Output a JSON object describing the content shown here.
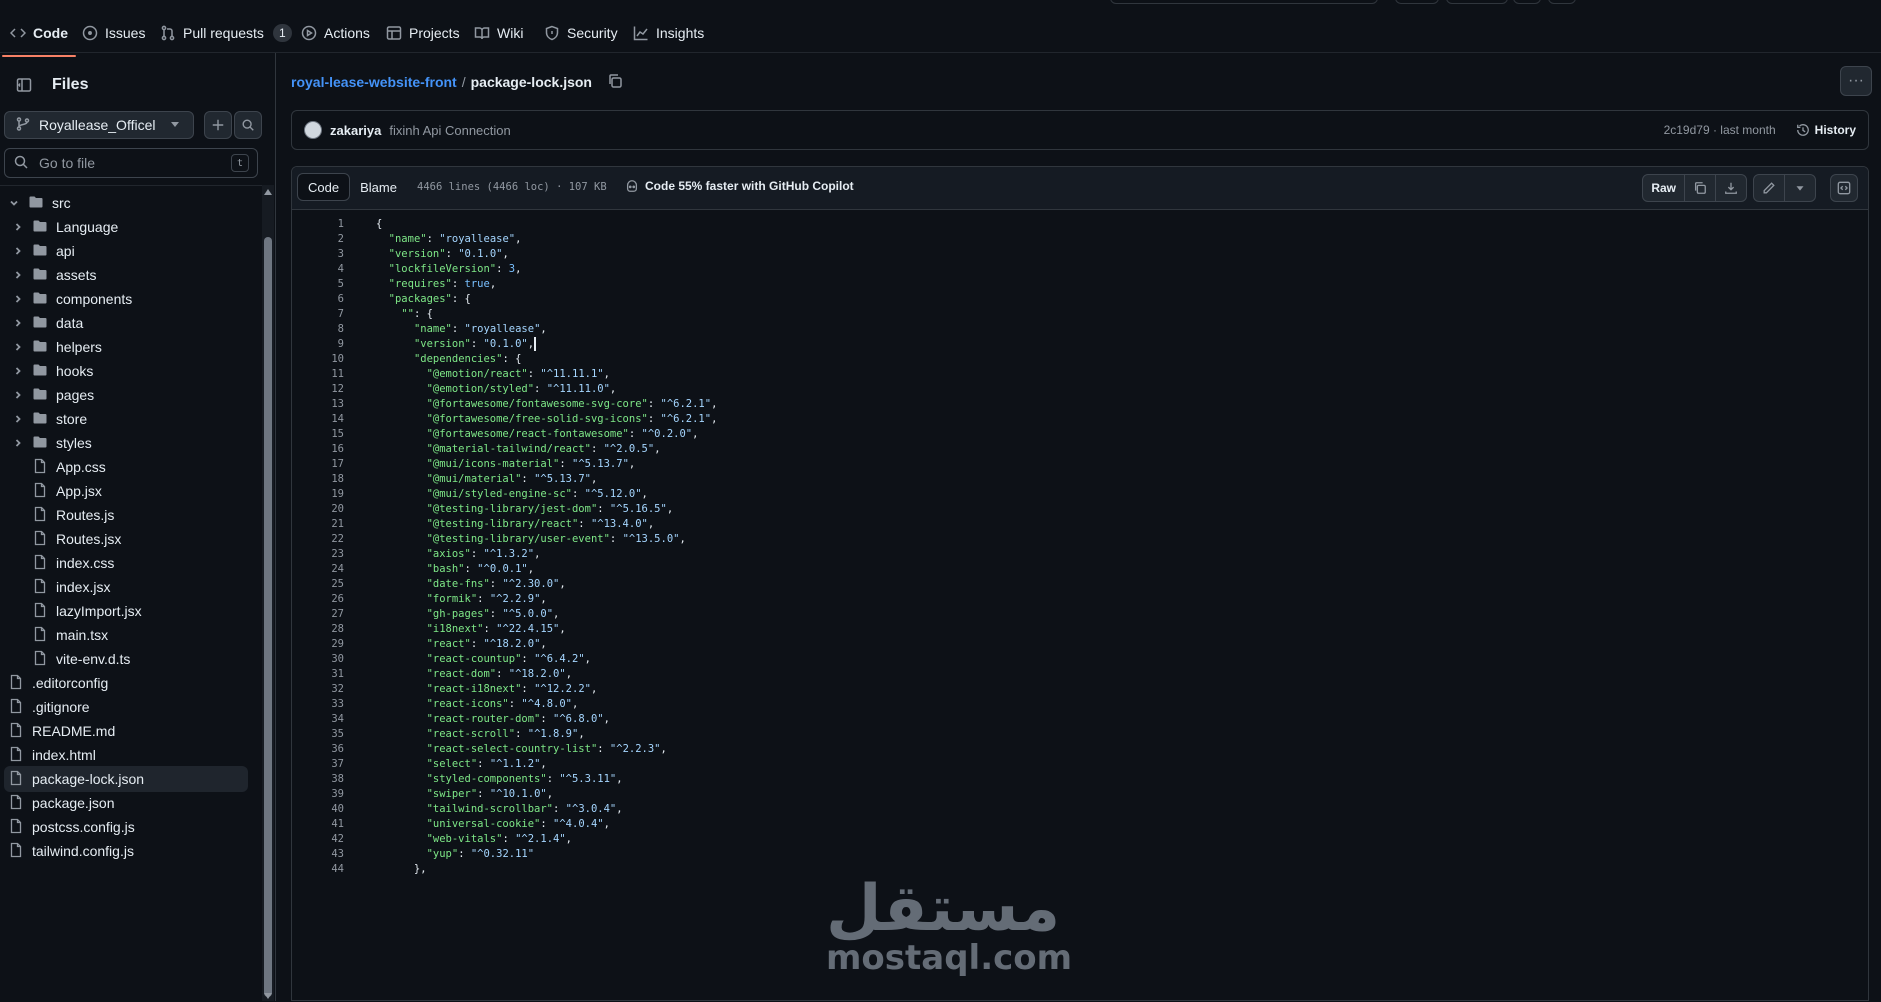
{
  "nav": {
    "tabs": [
      {
        "label": "Code",
        "icon": "code-icon",
        "selected": true
      },
      {
        "label": "Issues",
        "icon": "issue-icon"
      },
      {
        "label": "Pull requests",
        "icon": "pull-request-icon",
        "count": "1"
      },
      {
        "label": "Actions",
        "icon": "play-icon"
      },
      {
        "label": "Projects",
        "icon": "table-icon"
      },
      {
        "label": "Wiki",
        "icon": "book-icon"
      },
      {
        "label": "Security",
        "icon": "shield-icon"
      },
      {
        "label": "Insights",
        "icon": "graph-icon"
      }
    ]
  },
  "sidebar": {
    "title": "Files",
    "branch": "Royallease_Officel",
    "goto_placeholder": "Go to file",
    "goto_shortcut": "t",
    "tree": [
      {
        "label": "src",
        "type": "folder",
        "level": 0,
        "open": true
      },
      {
        "label": "Language",
        "type": "folder",
        "level": 1
      },
      {
        "label": "api",
        "type": "folder",
        "level": 1
      },
      {
        "label": "assets",
        "type": "folder",
        "level": 1
      },
      {
        "label": "components",
        "type": "folder",
        "level": 1
      },
      {
        "label": "data",
        "type": "folder",
        "level": 1
      },
      {
        "label": "helpers",
        "type": "folder",
        "level": 1
      },
      {
        "label": "hooks",
        "type": "folder",
        "level": 1
      },
      {
        "label": "pages",
        "type": "folder",
        "level": 1
      },
      {
        "label": "store",
        "type": "folder",
        "level": 1
      },
      {
        "label": "styles",
        "type": "folder",
        "level": 1
      },
      {
        "label": "App.css",
        "type": "file",
        "level": 1
      },
      {
        "label": "App.jsx",
        "type": "file",
        "level": 1
      },
      {
        "label": "Routes.js",
        "type": "file",
        "level": 1
      },
      {
        "label": "Routes.jsx",
        "type": "file",
        "level": 1
      },
      {
        "label": "index.css",
        "type": "file",
        "level": 1
      },
      {
        "label": "index.jsx",
        "type": "file",
        "level": 1
      },
      {
        "label": "lazyImport.jsx",
        "type": "file",
        "level": 1
      },
      {
        "label": "main.tsx",
        "type": "file",
        "level": 1
      },
      {
        "label": "vite-env.d.ts",
        "type": "file",
        "level": 1
      },
      {
        "label": ".editorconfig",
        "type": "file",
        "level": 0
      },
      {
        "label": ".gitignore",
        "type": "file",
        "level": 0
      },
      {
        "label": "README.md",
        "type": "file",
        "level": 0
      },
      {
        "label": "index.html",
        "type": "file",
        "level": 0
      },
      {
        "label": "package-lock.json",
        "type": "file",
        "level": 0,
        "active": true
      },
      {
        "label": "package.json",
        "type": "file",
        "level": 0
      },
      {
        "label": "postcss.config.js",
        "type": "file",
        "level": 0
      },
      {
        "label": "tailwind.config.js",
        "type": "file",
        "level": 0
      }
    ]
  },
  "breadcrumb": {
    "repo": "royal-lease-website-front",
    "separator": "/",
    "file": "package-lock.json"
  },
  "commit": {
    "author": "zakariya",
    "message": "fixinh Api Connection",
    "sha_time": "2c19d79 · last month",
    "history_label": "History"
  },
  "file_header": {
    "code_tab": "Code",
    "blame_tab": "Blame",
    "loc_info": "4466 lines (4466 loc) · 107 KB",
    "copilot_text": "Code 55% faster with GitHub Copilot",
    "raw_label": "Raw"
  },
  "code_lines": [
    "{",
    "  \"name\": \"royallease\",",
    "  \"version\": \"0.1.0\",",
    "  \"lockfileVersion\": 3,",
    "  \"requires\": true,",
    "  \"packages\": {",
    "    \"\": {",
    "      \"name\": \"royallease\",",
    "      \"version\": \"0.1.0\",",
    "      \"dependencies\": {",
    "        \"@emotion/react\": \"^11.11.1\",",
    "        \"@emotion/styled\": \"^11.11.0\",",
    "        \"@fortawesome/fontawesome-svg-core\": \"^6.2.1\",",
    "        \"@fortawesome/free-solid-svg-icons\": \"^6.2.1\",",
    "        \"@fortawesome/react-fontawesome\": \"^0.2.0\",",
    "        \"@material-tailwind/react\": \"^2.0.5\",",
    "        \"@mui/icons-material\": \"^5.13.7\",",
    "        \"@mui/material\": \"^5.13.7\",",
    "        \"@mui/styled-engine-sc\": \"^5.12.0\",",
    "        \"@testing-library/jest-dom\": \"^5.16.5\",",
    "        \"@testing-library/react\": \"^13.4.0\",",
    "        \"@testing-library/user-event\": \"^13.5.0\",",
    "        \"axios\": \"^1.3.2\",",
    "        \"bash\": \"^0.0.1\",",
    "        \"date-fns\": \"^2.30.0\",",
    "        \"formik\": \"^2.2.9\",",
    "        \"gh-pages\": \"^5.0.0\",",
    "        \"i18next\": \"^22.4.15\",",
    "        \"react\": \"^18.2.0\",",
    "        \"react-countup\": \"^6.4.2\",",
    "        \"react-dom\": \"^18.2.0\",",
    "        \"react-i18next\": \"^12.2.2\",",
    "        \"react-icons\": \"^4.8.0\",",
    "        \"react-router-dom\": \"^6.8.0\",",
    "        \"react-scroll\": \"^1.8.9\",",
    "        \"react-select-country-list\": \"^2.2.3\",",
    "        \"select\": \"^1.1.2\",",
    "        \"styled-components\": \"^5.3.11\",",
    "        \"swiper\": \"^10.1.0\",",
    "        \"tailwind-scrollbar\": \"^3.0.4\",",
    "        \"universal-cookie\": \"^4.0.4\",",
    "        \"web-vitals\": \"^2.1.4\",",
    "        \"yup\": \"^0.32.11\"",
    "      },"
  ],
  "watermark": {
    "arabic": "مستقل",
    "latin": "mostaql.com"
  },
  "colors": {
    "background": "#0d1117",
    "accent_link": "#4493f8",
    "selected_tab_underline": "#f78166",
    "json_key": "#7ee787",
    "json_string": "#a5d6ff",
    "json_number": "#79c0ff"
  }
}
